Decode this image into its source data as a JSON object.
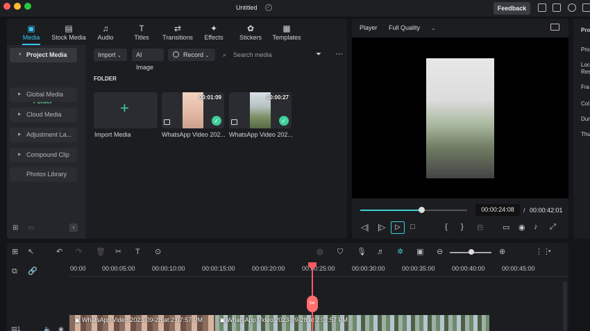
{
  "window": {
    "title": "Untitled"
  },
  "titlebar": {
    "feedback": "Feedback"
  },
  "tabs": [
    {
      "label": "Media",
      "icon": "media-icon",
      "active": true
    },
    {
      "label": "Stock Media",
      "icon": "stock-media-icon"
    },
    {
      "label": "Audio",
      "icon": "audio-icon"
    },
    {
      "label": "Titles",
      "icon": "titles-icon"
    },
    {
      "label": "Transitions",
      "icon": "transitions-icon"
    },
    {
      "label": "Effects",
      "icon": "effects-icon"
    },
    {
      "label": "Stickers",
      "icon": "stickers-icon"
    },
    {
      "label": "Templates",
      "icon": "templates-icon"
    }
  ],
  "sidebar": {
    "project_media": "Project Media",
    "folder": "Folder",
    "items": [
      "Global Media",
      "Cloud Media",
      "Adjustment La...",
      "Compound Clip",
      "Photos Library"
    ]
  },
  "toolbar": {
    "import": "Import",
    "ai_image": "AI Image",
    "record": "Record",
    "search_placeholder": "Search media"
  },
  "content": {
    "folder_label": "FOLDER",
    "import_media": "Import Media",
    "clips": [
      {
        "name": "WhatsApp Video 202...",
        "duration": "00:01:09"
      },
      {
        "name": "WhatsApp Video 202...",
        "duration": "00:00:27"
      }
    ]
  },
  "player": {
    "label": "Player",
    "quality": "Full Quality",
    "current_time": "00:00:24:08",
    "separator": "/",
    "total_time": "00:00:42:01",
    "progress": 0.57
  },
  "props": [
    "Pro",
    "Pro",
    "Loc",
    "Res",
    "Fra",
    "Col",
    "Dur",
    "Thu"
  ],
  "timeline": {
    "ruler": [
      "00:00",
      "00:00:05:00",
      "00:00:10:00",
      "00:00:15:00",
      "00:00:20:00",
      "00:00:25:00",
      "00:00:30:00",
      "00:00:35:00",
      "00:00:40:00",
      "00:00:45:00"
    ],
    "clip1_label": "WhatsApp Video 2023-09-28 at 2:07:57 PM",
    "clip2_label": "WhatsApp Video 2023-09-28 at 2:07:57 PM"
  },
  "colors": {
    "accent": "#39c6f0",
    "playhead": "#ff5a5f",
    "success": "#3fcf9c"
  }
}
